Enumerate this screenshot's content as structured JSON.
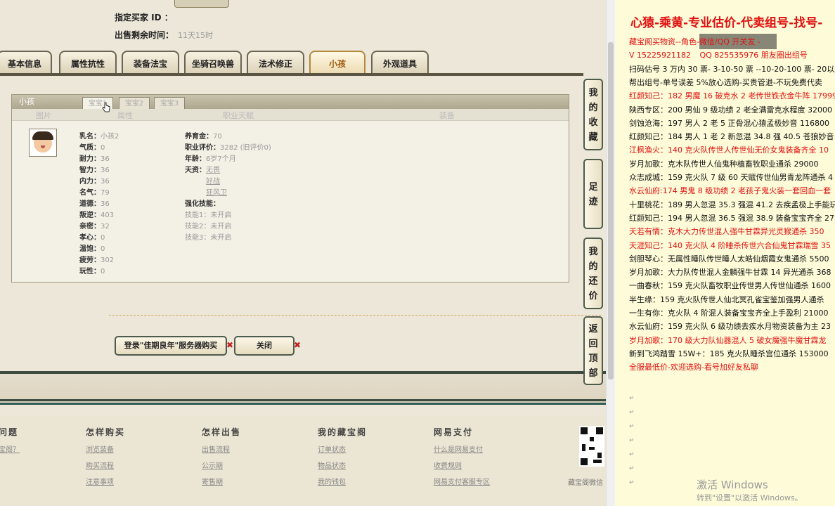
{
  "top": {
    "buyer_label": "指定买家 ID ：",
    "time_label": "出售剩余时间：",
    "time_value": "11天15时"
  },
  "tabs": [
    "基本信息",
    "属性抗性",
    "装备法宝",
    "坐骑召唤兽",
    "法术修正",
    "小孩",
    "外观道具"
  ],
  "panel": {
    "title": "小孩",
    "subtabs": [
      "宝宝1",
      "宝宝2",
      "宝宝3"
    ],
    "columns": [
      "图片",
      "属性",
      "职业天赋",
      "装备"
    ],
    "attrs_left": [
      {
        "k": "乳名：",
        "v": "小孩2"
      },
      {
        "k": "气质：",
        "v": "0"
      },
      {
        "k": "耐力：",
        "v": "36"
      },
      {
        "k": "智力：",
        "v": "36"
      },
      {
        "k": "内力：",
        "v": "36"
      },
      {
        "k": "名气：",
        "v": "79"
      },
      {
        "k": "道德：",
        "v": "36"
      },
      {
        "k": "叛逆：",
        "v": "403"
      },
      {
        "k": "亲密：",
        "v": "32"
      },
      {
        "k": "孝心：",
        "v": "0"
      },
      {
        "k": "温饱：",
        "v": "0"
      },
      {
        "k": "疲劳：",
        "v": "302"
      },
      {
        "k": "玩性：",
        "v": "0"
      }
    ],
    "attrs_right": {
      "fund_k": "养育金：",
      "fund_v": "70",
      "eval_k": "职业评价：",
      "eval_v": "3282 (旧评价0)",
      "age_k": "年龄：",
      "age_v": "6岁7个月",
      "talent_k": "天资：",
      "talents": [
        "无畏",
        "好战",
        "狂风卫"
      ],
      "skill_k": "强化技能：",
      "skills": [
        {
          "k": "技能1：",
          "v": "未开启"
        },
        {
          "k": "技能2：",
          "v": "未开启"
        },
        {
          "k": "技能3：",
          "v": "未开启"
        }
      ]
    }
  },
  "buttons": {
    "login": "登录\"佳期良年\"服务器购买",
    "close": "关闭",
    "x": "✖"
  },
  "sidebar_buttons": [
    [
      "我",
      "的",
      "收",
      "藏"
    ],
    [
      "足",
      "迹"
    ],
    [
      "我",
      "的",
      "还",
      "价"
    ],
    [
      "返",
      "回",
      "顶",
      "部"
    ]
  ],
  "footer": {
    "cols": [
      {
        "h": "问题",
        "links": [
          "宝阁？"
        ]
      },
      {
        "h": "怎样购买",
        "links": [
          "浏览装备",
          "购买流程",
          "注意事项"
        ]
      },
      {
        "h": "怎样出售",
        "links": [
          "出售流程",
          "公示期",
          "寄售期"
        ]
      },
      {
        "h": "我的藏宝阁",
        "links": [
          "订单状态",
          "物品状态",
          "我的钱包"
        ]
      },
      {
        "h": "网易支付",
        "links": [
          "什么是网易支付",
          "收费规则",
          "网易支付客服专区"
        ]
      }
    ],
    "qr_label": "藏宝阁微信"
  },
  "right": {
    "title": "心猿-乘黄-专业估价-代卖组号-找号-",
    "lines": [
      {
        "t": "藏宝阁买物资--角色-微信/QQ 开关发 -",
        "c": "red"
      },
      {
        "t": "V 15225921182   QQ 825535976 朋友圈出组号",
        "c": "red"
      },
      {
        "t": "扫码估号 3 万内 30 票- 3-10-50 票 --10-20-100 票- 20以上 1",
        "c": "dark"
      },
      {
        "t": "帮出组号-单号误差 5%放心选购-买贵管退-不玩免费代卖",
        "c": "dark"
      },
      {
        "t": "红颜知己：182 男魔 16 破克水 2 老传世铁衣金牛阵 17999",
        "c": "red"
      },
      {
        "t": "陕西专区：200 男仙 9 级功绩 2 老全满雷克水程度 32000",
        "c": "dark"
      },
      {
        "t": "剑蚀沧海：197 男人 2 老 5 正骨混心猿孟极妙音 116800",
        "c": "dark"
      },
      {
        "t": "红颜知己：184 男人 1 老 2 新忽混 34.8 强 40.5 苍狼妙音 2",
        "c": "dark"
      },
      {
        "t": "江枫渔火：140 克火队传世人传世仙无价女鬼装备齐全 10",
        "c": "red"
      },
      {
        "t": "岁月加歌：克木队传世人仙鬼种植畜牧职业通杀 29000",
        "c": "dark"
      },
      {
        "t": "众志成城：159 克火队 7 级 60 天赋传世仙男青龙阵通杀 4",
        "c": "dark"
      },
      {
        "t": "水云仙府:174 男鬼 8 级功绩 2 老孩子鬼火装一套回血一套",
        "c": "red"
      },
      {
        "t": "十里桃花：189 男人忽混 35.3 强混 41.2 去疾孟极上手能玩",
        "c": "dark"
      },
      {
        "t": "红颜知己：194 男人忽混 36.5 强混 38.9 装备宝宝齐全 275",
        "c": "dark"
      },
      {
        "t": "天若有情：克木大力传世混人强牛甘霖异光灵猴通杀 350",
        "c": "red"
      },
      {
        "t": "天涯知己：140 克火队 4 阶睡杀传世六合仙鬼甘霖瑞雪 35",
        "c": "red"
      },
      {
        "t": "剑胆琴心：无属性睡队传世睡人太皓仙烟霞女鬼通杀 5500",
        "c": "dark"
      },
      {
        "t": "岁月加歌：大力队传世混人金麟强牛甘霖 14 异光通杀 368",
        "c": "dark"
      },
      {
        "t": "一曲春秋：159 克火队畜牧职业传世男人传世仙通杀 1600",
        "c": "dark"
      },
      {
        "t": "半生缘：159 克火队传世人仙北冥孔雀宝鉴加强男人通杀",
        "c": "dark"
      },
      {
        "t": "一生有你：克火队 4 阶混人装备宝宝齐全上手盈利 21000",
        "c": "dark"
      },
      {
        "t": "水云仙府：159 克火队 6 级功绩去疾水月物资装备为主 23",
        "c": "dark"
      },
      {
        "t": "岁月加歌：170 级大力队仙器混人 5 破女魔强牛魔甘霖龙",
        "c": "red"
      },
      {
        "t": "新到飞鸿踏雪 15W+：185 克火队睡杀宫位通杀 153000",
        "c": "dark"
      },
      {
        "t": "全服最低价-欢迎选购-看号加好友私聊",
        "c": "red"
      }
    ],
    "watermark": "激活 Windows",
    "watermark_sub": "转到\"设置\"以激活 Windows。"
  }
}
